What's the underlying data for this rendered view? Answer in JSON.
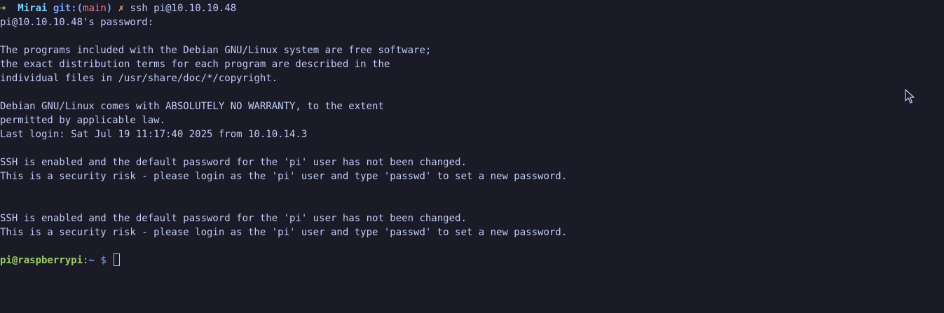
{
  "prompt": {
    "arrow": "➜",
    "directory": "Mirai",
    "git_label": "git:(",
    "branch": "main",
    "git_close": ")",
    "dirty_mark": "✗",
    "command": "ssh pi@10.10.10.48"
  },
  "output": [
    "pi@10.10.10.48's password:",
    "",
    "The programs included with the Debian GNU/Linux system are free software;",
    "the exact distribution terms for each program are described in the",
    "individual files in /usr/share/doc/*/copyright.",
    "",
    "Debian GNU/Linux comes with ABSOLUTELY NO WARRANTY, to the extent",
    "permitted by applicable law.",
    "Last login: Sat Jul 19 11:17:40 2025 from 10.10.14.3",
    "",
    "SSH is enabled and the default password for the 'pi' user has not been changed.",
    "This is a security risk - please login as the 'pi' user and type 'passwd' to set a new password.",
    "",
    "",
    "SSH is enabled and the default password for the 'pi' user has not been changed.",
    "This is a security risk - please login as the 'pi' user and type 'passwd' to set a new password.",
    ""
  ],
  "remote_prompt": {
    "user_host": "pi@raspberrypi",
    "separator": ":",
    "path": "~",
    "symbol": "$"
  },
  "colors": {
    "background": "#1a1b26",
    "foreground": "#c0caf5",
    "green": "#9ece6a",
    "cyan": "#7dcfff",
    "blue": "#7aa2f7",
    "red": "#f7768e",
    "yellow": "#e0af68"
  },
  "icons": {
    "mouse_pointer": "mouse-pointer-icon"
  }
}
